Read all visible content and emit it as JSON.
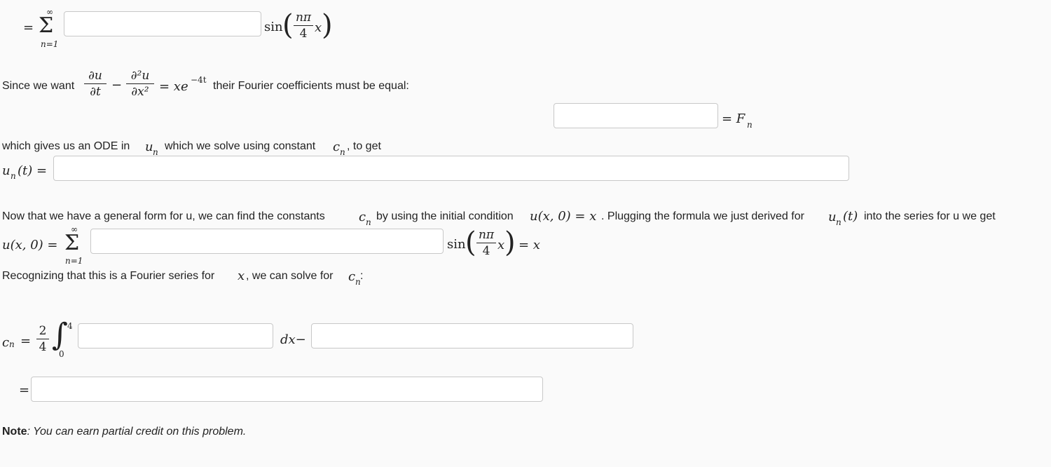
{
  "row1": {
    "eq": "=",
    "sum_upper": "∞",
    "sum_lower": "n=1",
    "sin": "sin",
    "frac_num": "nπ",
    "frac_den": "4",
    "x": "x"
  },
  "since": {
    "prefix": "Since we want",
    "du": "∂u",
    "dt": "∂t",
    "minus": "−",
    "d2u": "∂²u",
    "dx2": "∂x²",
    "rhs": "= xe",
    "exp": "−4t",
    "suffix": "their Fourier coefficients must be equal:"
  },
  "fn_row": {
    "rhs": "= F",
    "sub": "n"
  },
  "ode": {
    "text1": "which gives us an ODE in",
    "u": "u",
    "u_sub": "n",
    "text2": "which we solve using constant",
    "c": "c",
    "c_sub": "n",
    "text3": ", to get",
    "lhs": "u",
    "lhs_sub": "n",
    "lhs_arg": "(t) ="
  },
  "now": {
    "text1": "Now that we have a general form for u, we can find the constants",
    "c": "c",
    "c_sub": "n",
    "text2": "by using the initial condition",
    "cond": "u(x, 0) = x",
    "text3": ". Plugging the formula we just derived for",
    "u": "u",
    "u_sub": "n",
    "u_arg": "(t)",
    "text4": "into the series for u we get"
  },
  "series": {
    "lhs": "u(x, 0) =",
    "sum_upper": "∞",
    "sum_lower": "n=1",
    "sin": "sin",
    "frac_num": "nπ",
    "frac_den": "4",
    "x": "x",
    "rhs": "= x"
  },
  "recognize": {
    "text1": "Recognizing that this is a Fourier series for",
    "x": "x",
    "text2": ", we can solve for",
    "c": "c",
    "c_sub": "n",
    "colon": ":"
  },
  "cn": {
    "lhs": "c",
    "lhs_sub": "n",
    "eq": "=",
    "frac_num": "2",
    "frac_den": "4",
    "int_upper": "4",
    "int_lower": "0",
    "dx": "dx−"
  },
  "final": {
    "eq": "="
  },
  "note": {
    "label": "Note",
    "text": ": You can earn partial credit on this problem."
  }
}
